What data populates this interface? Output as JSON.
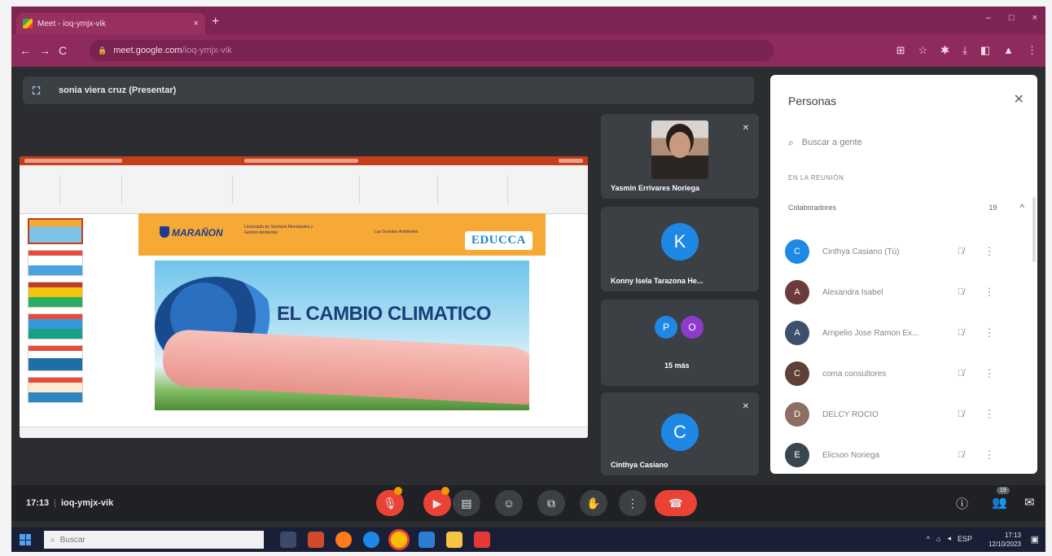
{
  "browser": {
    "tab_title": "Meet - ioq-ymjx-vik",
    "tab_close": "×",
    "new_tab": "+",
    "window_controls": [
      "–",
      "□",
      "×"
    ],
    "url_host": "meet.google.com",
    "url_path": "/ioq-ymjx-vik",
    "nav": {
      "back": "←",
      "forward": "→",
      "reload": "C"
    },
    "toolbar_icons": [
      "⊞",
      "☆",
      "✱",
      "⤓",
      "◧",
      "▲",
      "⋮"
    ]
  },
  "presenter": {
    "label": "sonia viera cruz (Presentar)"
  },
  "slide": {
    "org": "MARAÑON",
    "header_text_1": "Licenciada de Servicios Municipales y Gestion Ambiental",
    "header_text_2": "Las Grandes Ambientes",
    "brand": "EDUCCA",
    "title": "EL CAMBIO CLIMATICO"
  },
  "tiles": [
    {
      "name": "Yasmin Errivares Noriega",
      "mic": "✕"
    },
    {
      "name": "Konny Isela Tarazona He...",
      "avatar": "K",
      "avatar_color": "#1e88e5"
    },
    {
      "name": "15 más",
      "avatars": [
        {
          "letter": "P",
          "color": "#1e88e5"
        },
        {
          "letter": "O",
          "color": "#8e3acb"
        }
      ]
    },
    {
      "name": "Cinthya Casiano",
      "avatar": "C",
      "avatar_color": "#1e88e5",
      "mic": "✕"
    }
  ],
  "people_panel": {
    "title": "Personas",
    "close": "✕",
    "search_placeholder": "Buscar a gente",
    "section_label": "EN LA REUNIÓN",
    "group_label": "Colaboradores",
    "group_count": "19",
    "group_chevron": "^",
    "participants": [
      {
        "name": "Cinthya Casiano (Tú)",
        "initial": "C",
        "color": "#1e88e5"
      },
      {
        "name": "Alexandra Isabel",
        "initial": "A",
        "color": "#6b3a3a"
      },
      {
        "name": "Arnpelio Jose Ramon Ex...",
        "initial": "A",
        "color": "#3c4f6b"
      },
      {
        "name": "coma consultores",
        "initial": "C",
        "color": "#5d4037"
      },
      {
        "name": "DELCY ROCIO",
        "initial": "D",
        "color": "#8d6e63"
      },
      {
        "name": "Elicson Noriega",
        "initial": "E",
        "color": "#37474f"
      }
    ]
  },
  "controls": {
    "time": "17:13",
    "meeting_code": "ioq-ymjx-vik",
    "info_icon": "ⓘ",
    "people_icon": "👥",
    "people_badge": "19",
    "chat_icon": "✉"
  },
  "taskbar": {
    "search_placeholder": "Buscar",
    "language": "ESP",
    "time": "17:13",
    "date": "12/10/2023"
  }
}
